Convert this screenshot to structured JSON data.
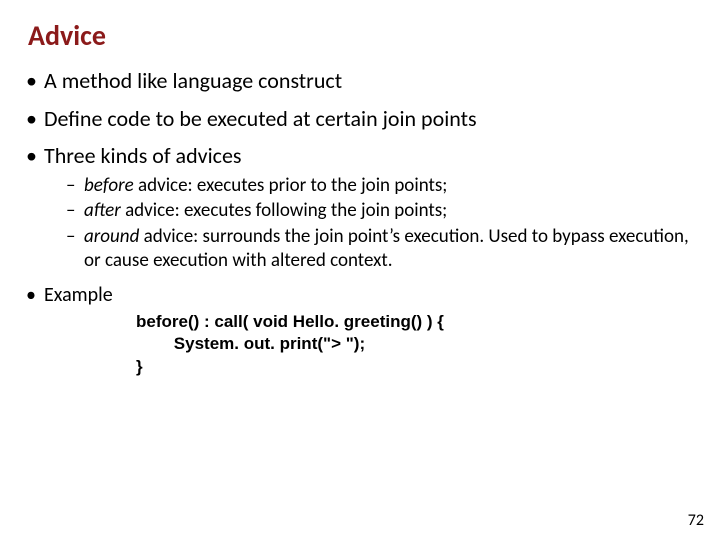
{
  "title": "Advice",
  "bullets": {
    "b1": "A method like language construct",
    "b2": "Define code to be executed at certain join points",
    "b3": "Three kinds of advices",
    "sub": {
      "s1_kw": "before",
      "s1_rest": " advice: executes prior to the join points;",
      "s2_kw": "after",
      "s2_rest": " advice: executes following the join points;",
      "s3_kw": "around",
      "s3_rest": " advice: surrounds the join point’s execution. Used to bypass execution, or cause execution with altered context."
    },
    "example_label": "Example",
    "code_line1": "before() : call( void Hello. greeting() ) {",
    "code_line2": "        System. out. print(\"> \");",
    "code_line3": "}"
  },
  "page_number": "72"
}
